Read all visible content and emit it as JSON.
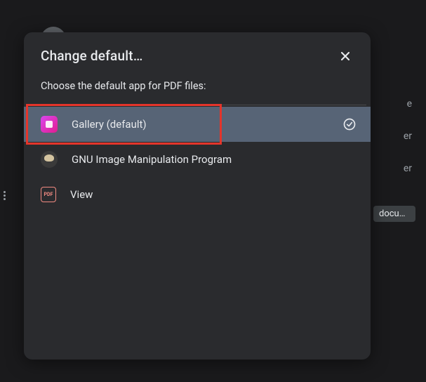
{
  "dialog": {
    "title": "Change default…",
    "subtitle": "Choose the default app for PDF files:",
    "apps": [
      {
        "label": "Gallery (default)",
        "icon": "gallery-icon",
        "selected": true,
        "highlighted": true
      },
      {
        "label": "GNU Image Manipulation Program",
        "icon": "gimp-icon",
        "selected": false,
        "highlighted": false
      },
      {
        "label": "View",
        "icon": "pdf-view-icon",
        "selected": false,
        "highlighted": false
      }
    ]
  },
  "background": {
    "items": [
      "e",
      "er",
      "er"
    ],
    "tooltip": "docum…"
  },
  "icon_text": {
    "pdf": "PDF"
  }
}
